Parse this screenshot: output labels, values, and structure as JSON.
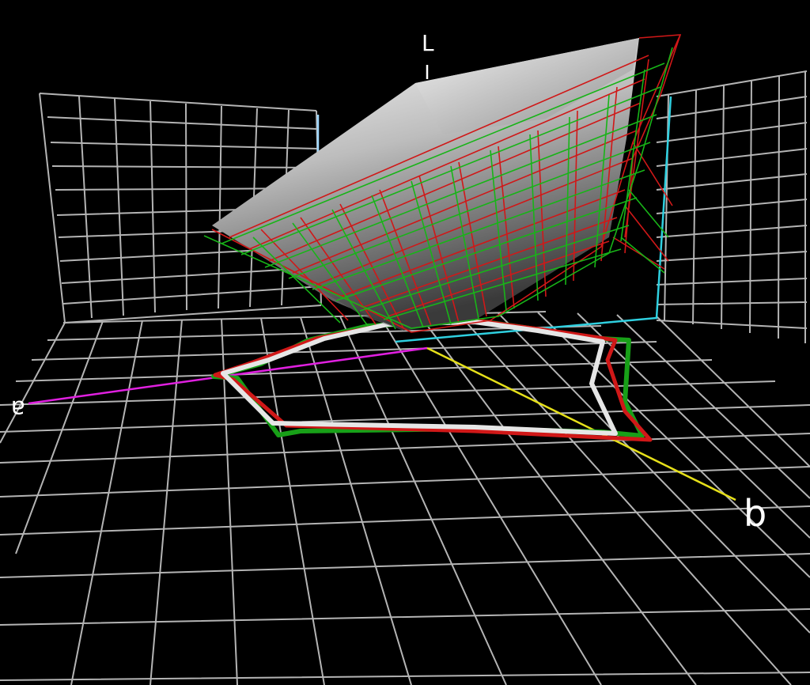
{
  "scene": {
    "background": "#000000",
    "grid_color": "#b4b4b4",
    "axes": [
      {
        "key": "L",
        "label": "L",
        "color": "#9fd8ff"
      },
      {
        "key": "a",
        "label": "a",
        "color": "#e020e0"
      },
      {
        "key": "b",
        "label": "b",
        "color": "#e6e01a"
      }
    ],
    "gamuts": [
      {
        "name": "solid",
        "render": "shaded-surface",
        "color": "#e0e0e0"
      },
      {
        "name": "red",
        "render": "wireframe",
        "color": "#d01818"
      },
      {
        "name": "green",
        "render": "wireframe",
        "color": "#18b418"
      }
    ]
  }
}
